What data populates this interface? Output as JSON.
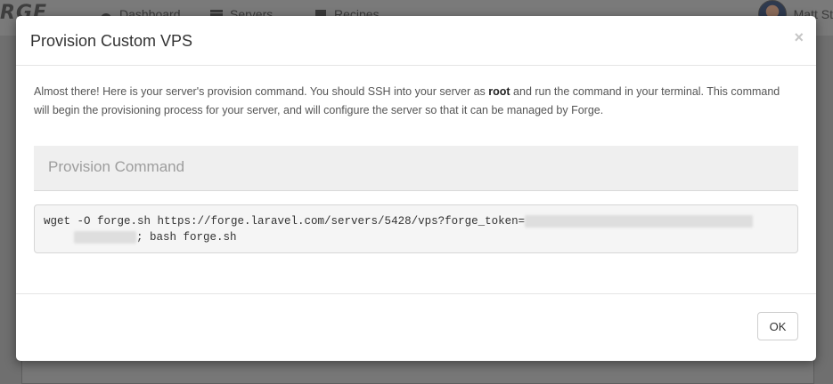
{
  "background": {
    "logo": "RGE",
    "nav": [
      {
        "label": "Dashboard",
        "icon": "dashboard-icon"
      },
      {
        "label": "Servers",
        "icon": "server-icon"
      },
      {
        "label": "Recipes",
        "icon": "recipe-icon"
      }
    ],
    "user_name": "Matt St"
  },
  "modal": {
    "title": "Provision Custom VPS",
    "close_label": "×",
    "intro_before": "Almost there! Here is your server's provision command. You should SSH into your server as ",
    "intro_bold": "root",
    "intro_after": " and run the command in your terminal. This command will begin the provisioning process for your server, and will configure the server so that it can be managed by Forge.",
    "section_title": "Provision Command",
    "command_prefix": "wget -O forge.sh https://forge.laravel.com/servers/5428/vps?forge_token=",
    "command_suffix": "; bash forge.sh",
    "ok_label": "OK"
  }
}
